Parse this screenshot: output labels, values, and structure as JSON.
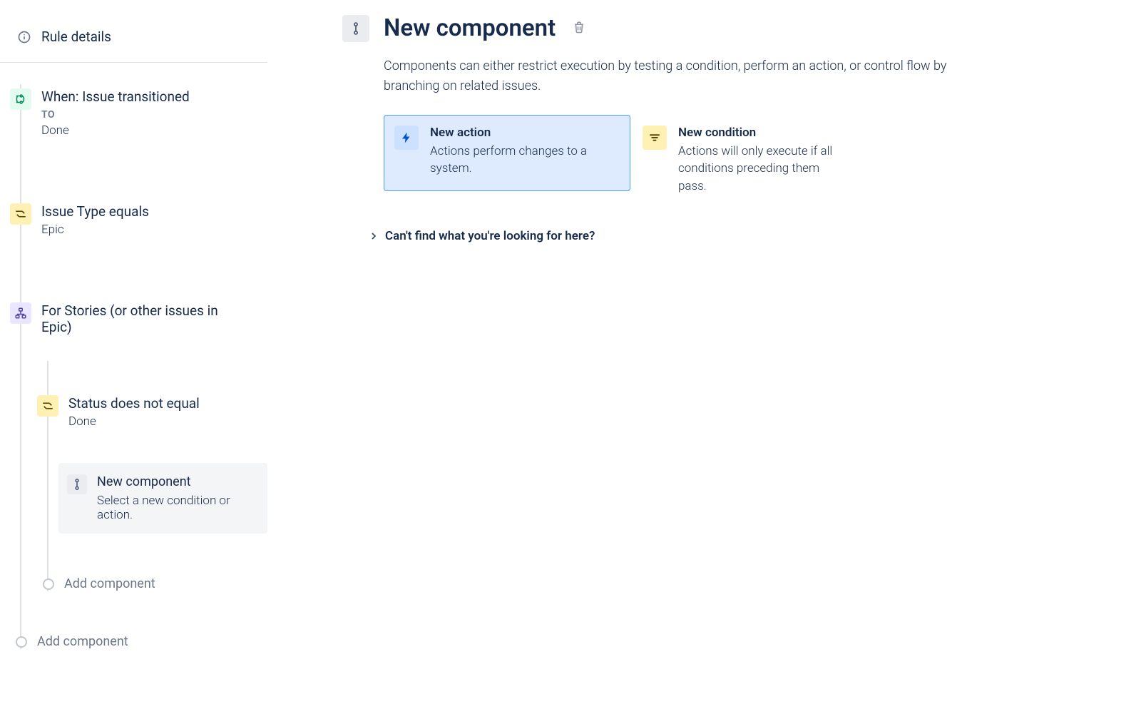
{
  "sidebar": {
    "header": "Rule details",
    "trigger": {
      "title": "When: Issue transitioned",
      "to_label": "TO",
      "to_value": "Done"
    },
    "condition": {
      "title": "Issue Type equals",
      "value": "Epic"
    },
    "branch": {
      "title": "For Stories (or other issues in Epic)"
    },
    "branch_cond": {
      "title": "Status does not equal",
      "value": "Done"
    },
    "new_component": {
      "title": "New component",
      "desc": "Select a new condition or action."
    },
    "add_component": "Add component",
    "add_component_outer": "Add component"
  },
  "main": {
    "title": "New component",
    "subtitle": "Components can either restrict execution by testing a condition, perform an action, or control flow by branching on related issues.",
    "action_card": {
      "title": "New action",
      "desc": "Actions perform changes to a system."
    },
    "condition_card": {
      "title": "New condition",
      "desc": "Actions will only execute if all conditions preceding them pass."
    },
    "help_link": "Can't find what you're looking for here?"
  }
}
